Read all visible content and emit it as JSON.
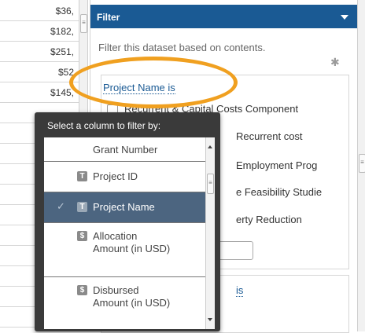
{
  "table": {
    "amounts": [
      "$36,",
      "$182,",
      "$251,",
      "$52",
      "$145,",
      "",
      "",
      "",
      "",
      "",
      "",
      "",
      "",
      "",
      ""
    ]
  },
  "panel": {
    "title": "Filter",
    "description": "Filter this dataset based on contents.",
    "gear_icon": "gear-icon"
  },
  "filter": {
    "column_label": "Project Name",
    "operator": "is",
    "options": [
      "Recurrent & Capital Costs Component",
      "Recurrent cost",
      "Employment Prog",
      "e Feasibility Studie",
      "erty Reduction"
    ],
    "second_link": "is"
  },
  "dropdown": {
    "title": "Select a column to filter by:",
    "items": [
      {
        "label": "Grant Number",
        "type_badge": "",
        "selected": false
      },
      {
        "label": "Project ID",
        "type_badge": "T",
        "selected": false
      },
      {
        "label": "Project Name",
        "type_badge": "T",
        "selected": true,
        "check": "✓"
      },
      {
        "label": "Allocation Amount (in USD)",
        "type_badge": "$",
        "selected": false
      },
      {
        "label": "Disbursed Amount (in USD)",
        "type_badge": "$",
        "selected": false
      }
    ]
  },
  "colors": {
    "header_blue": "#1a5a94",
    "highlight_orange": "#f0a020",
    "dropdown_dark": "#3a3a3a",
    "selected_row": "#4c6580"
  }
}
